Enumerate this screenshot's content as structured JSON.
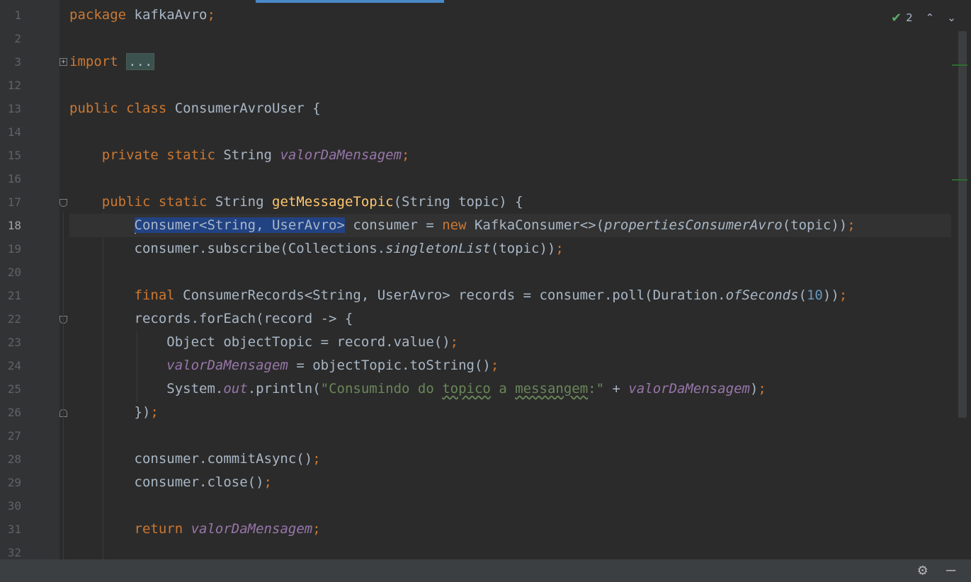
{
  "editor": {
    "line_numbers": [
      "1",
      "2",
      "3",
      "12",
      "13",
      "14",
      "15",
      "16",
      "17",
      "18",
      "19",
      "20",
      "21",
      "22",
      "23",
      "24",
      "25",
      "26",
      "27",
      "28",
      "29",
      "30",
      "31",
      "32"
    ],
    "current_line": "18"
  },
  "inspection": {
    "count": "2",
    "check_glyph": "✔",
    "up_glyph": "⌃",
    "down_glyph": "⌄"
  },
  "tokens": {
    "package": "package",
    "package_name": " kafkaAvro",
    "semi": ";",
    "import": "import",
    "import_dots": "...",
    "public": "public",
    "class": " class",
    "class_name": " ConsumerAvroUser {",
    "private": "private",
    "static": " static",
    "string_type": " String ",
    "field": "valorDaMensagem",
    "method_sig_return": " String ",
    "method_name": "getMessageTopic",
    "method_params": "(String topic) {",
    "l18_selected": "Consumer<String, UserAvro>",
    "l18_mid": " consumer = ",
    "new": "new",
    "l18_ctor": " KafkaConsumer<>(",
    "l18_call": "propertiesConsumerAvro",
    "l18_end": "(topic))",
    "l19_a": "consumer.subscribe(Collections.",
    "l19_call": "singletonList",
    "l19_end": "(topic))",
    "final": "final",
    "l21_a": " ConsumerRecords<String, UserAvro> records = consumer.poll(Duration.",
    "l21_call": "ofSeconds",
    "l21_open": "(",
    "l21_num": "10",
    "l21_close": "))",
    "l22": "records.forEach(record -> {",
    "l23": "Object objectTopic = record.value()",
    "l24_a": " = objectTopic.toString()",
    "l25_a": "System.",
    "out": "out",
    "l25_b": ".println(",
    "str_a": "\"Consumindo do ",
    "str_typo1": "topico",
    "str_b": " a ",
    "str_typo2": "messangem",
    "str_c": ":\"",
    "l25_plus": " + ",
    "l25_end": ")",
    "l26": "})",
    "l28": "consumer.commitAsync()",
    "l29": "consumer.close()",
    "return": "return"
  },
  "bottom": {
    "gear_glyph": "⚙",
    "minus_glyph": "—"
  }
}
